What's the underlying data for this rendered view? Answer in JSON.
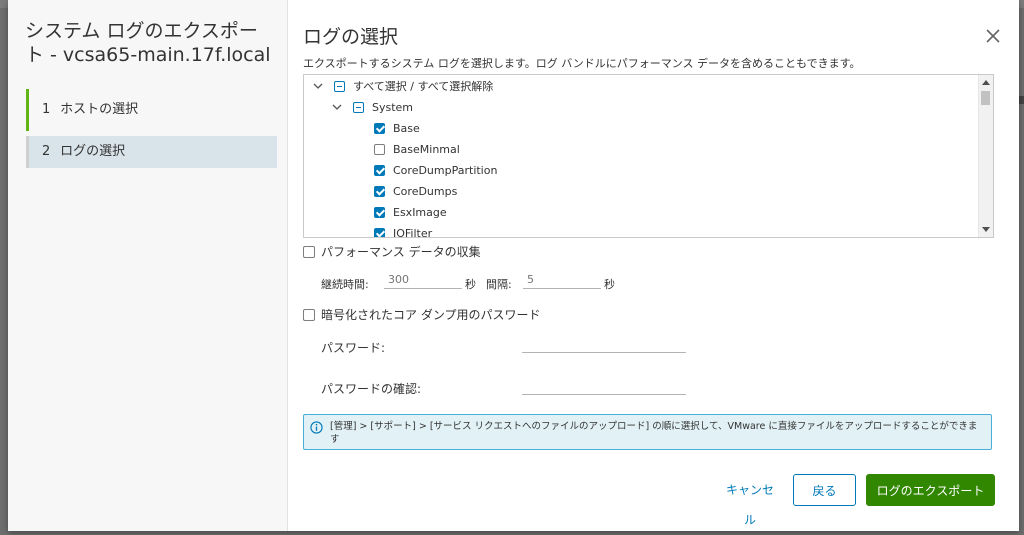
{
  "wizard": {
    "title": "システム ログのエクスポート - vcsa65-main.17f.local",
    "steps": [
      {
        "num": "1",
        "label": "ホストの選択"
      },
      {
        "num": "2",
        "label": "ログの選択"
      }
    ]
  },
  "page": {
    "title": "ログの選択",
    "description": "エクスポートするシステム ログを選択します。ログ バンドルにパフォーマンス データを含めることもできます。"
  },
  "tree": {
    "select_all_label": "すべて選択 / すべて選択解除",
    "group_label": "System",
    "items": [
      {
        "label": "Base",
        "checked": true
      },
      {
        "label": "BaseMinmal",
        "checked": false
      },
      {
        "label": "CoreDumpPartition",
        "checked": true
      },
      {
        "label": "CoreDumps",
        "checked": true
      },
      {
        "label": "EsxImage",
        "checked": true
      },
      {
        "label": "IOFilter",
        "checked": true
      }
    ]
  },
  "performance": {
    "label": "パフォーマンス データの収集",
    "duration_label": "継続時間:",
    "duration_placeholder": "300",
    "duration_unit": "秒",
    "interval_label": "間隔:",
    "interval_placeholder": "5",
    "interval_unit": "秒"
  },
  "encryption": {
    "label": "暗号化されたコア ダンプ用のパスワード",
    "password_label": "パスワード:",
    "confirm_label": "パスワードの確認:"
  },
  "info": {
    "text": "[管理] > [サポート] > [サービス リクエストへのファイルのアップロード] の順に選択して、VMware に直接ファイルをアップロードすることができます"
  },
  "buttons": {
    "cancel": "キャンセル",
    "back": "戻る",
    "export": "ログのエクスポート"
  },
  "colors": {
    "accent": "#0079b8",
    "primary_button": "#318700",
    "step_done": "#60b515",
    "info_border": "#49afd9"
  }
}
